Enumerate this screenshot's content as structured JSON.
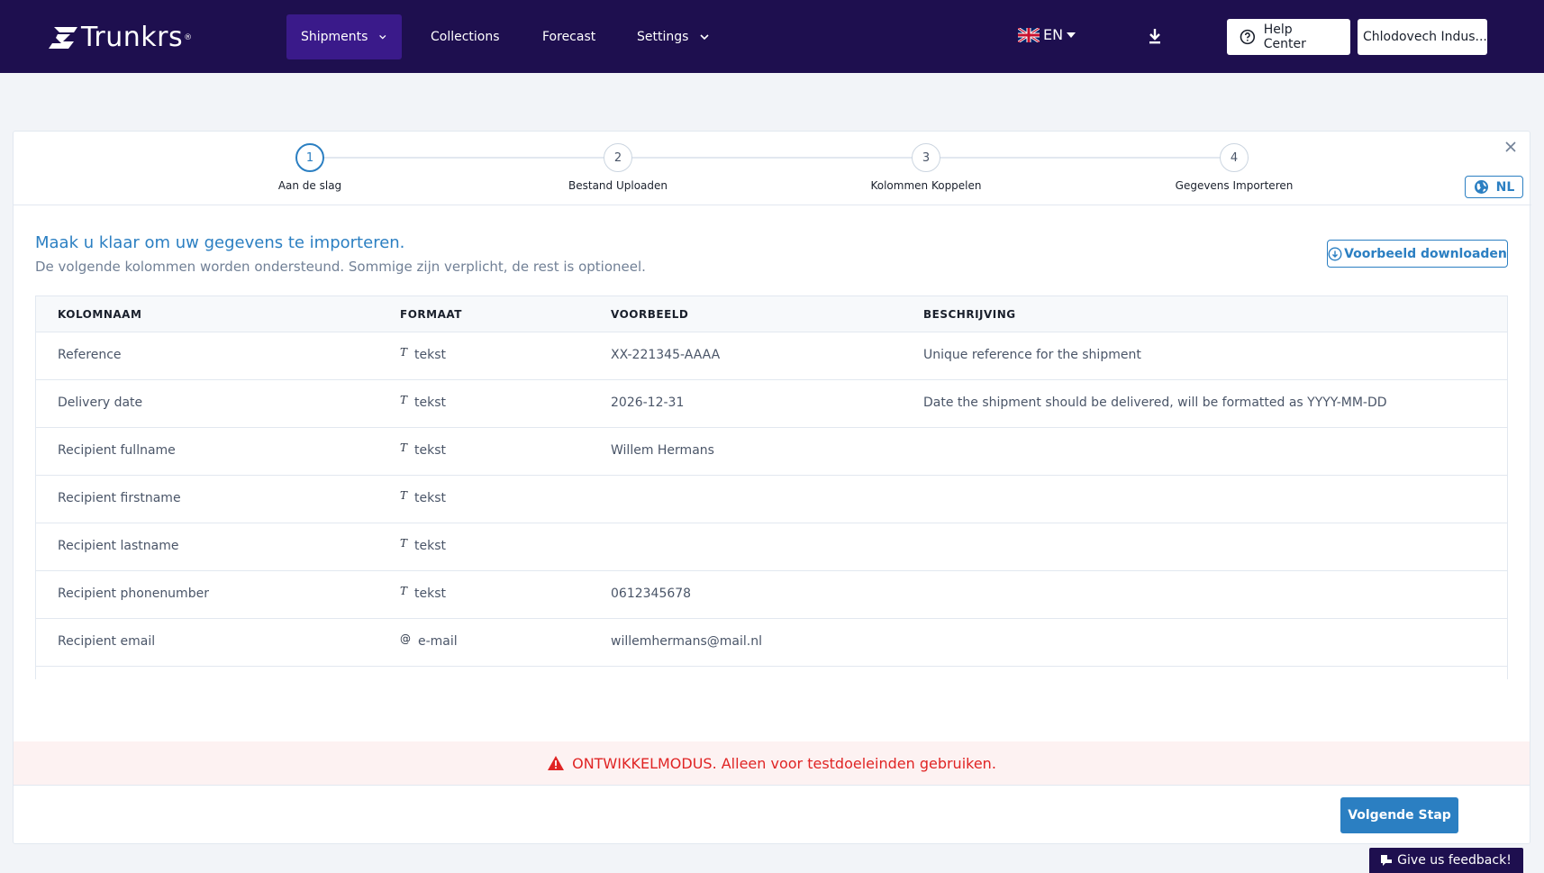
{
  "brand": {
    "name": "Trunkrs",
    "tm": "®"
  },
  "nav": {
    "items": [
      {
        "label": "Shipments",
        "dropdown": true,
        "active": true
      },
      {
        "label": "Collections",
        "dropdown": false
      },
      {
        "label": "Forecast",
        "dropdown": false
      },
      {
        "label": "Settings",
        "dropdown": true
      }
    ],
    "language": "EN",
    "help_label": "Help Center",
    "user_label": "Chlodovech Indus..."
  },
  "stepper": {
    "steps": [
      {
        "number": "1",
        "label": "Aan de slag",
        "active": true
      },
      {
        "number": "2",
        "label": "Bestand Uploaden"
      },
      {
        "number": "3",
        "label": "Kolommen Koppelen"
      },
      {
        "number": "4",
        "label": "Gegevens Importeren"
      }
    ],
    "locale_label": "NL"
  },
  "intro": {
    "title": "Maak u klaar om uw gegevens te importeren.",
    "subtitle": "De volgende kolommen worden ondersteund. Sommige zijn verplicht, de rest is optioneel.",
    "sample_button": "Voorbeeld downloaden"
  },
  "table": {
    "headers": [
      "KOLOMNAAM",
      "FORMAAT",
      "VOORBEELD",
      "BESCHRIJVING"
    ],
    "rows": [
      {
        "name": "Reference",
        "icon": "T",
        "format": "tekst",
        "example": "XX-221345-AAAA",
        "description": "Unique reference for the shipment"
      },
      {
        "name": "Delivery date",
        "icon": "T",
        "format": "tekst",
        "example": "2026-12-31",
        "description": "Date the shipment should be delivered, will be formatted as YYYY-MM-DD"
      },
      {
        "name": "Recipient fullname",
        "icon": "T",
        "format": "tekst",
        "example": "Willem Hermans",
        "description": ""
      },
      {
        "name": "Recipient firstname",
        "icon": "T",
        "format": "tekst",
        "example": "",
        "description": ""
      },
      {
        "name": "Recipient lastname",
        "icon": "T",
        "format": "tekst",
        "example": "",
        "description": ""
      },
      {
        "name": "Recipient phonenumber",
        "icon": "T",
        "format": "tekst",
        "example": "0612345678",
        "description": ""
      },
      {
        "name": "Recipient email",
        "icon": "@",
        "format": "e-mail",
        "example": "willemhermans@mail.nl",
        "description": ""
      }
    ]
  },
  "dev_banner": "ONTWIKKELMODUS. Alleen voor testdoeleinden gebruiken.",
  "next_button": "Volgende Stap",
  "feedback_label": "Give us feedback!",
  "colors": {
    "nav_bg": "#1e0f4f",
    "accent": "#2b7fc2",
    "danger": "#e02424"
  }
}
